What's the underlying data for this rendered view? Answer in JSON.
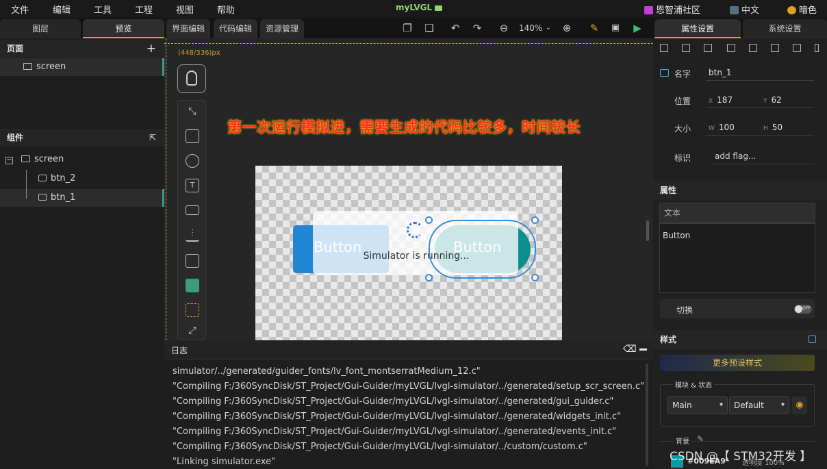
{
  "menu": [
    "文件",
    "编辑",
    "工具",
    "工程",
    "视图",
    "帮助"
  ],
  "app_title": "myLVGL",
  "right_menu": {
    "community": "恩智浦社区",
    "language": "中文",
    "theme": "暗色"
  },
  "left": {
    "tabs": [
      "图层",
      "预览"
    ],
    "pages_header": "页面",
    "page_items": [
      "screen"
    ],
    "components_header": "组件",
    "tree": [
      "screen",
      "btn_2",
      "btn_1"
    ]
  },
  "center": {
    "tabs": [
      "界面编辑",
      "代码编辑",
      "资源管理"
    ],
    "zoom": "140%",
    "coord": "(448/336)px",
    "notice": "第一次运行模拟进，需要生成的代码比较多，时间较长",
    "btn_labels": [
      "Button",
      "Button"
    ],
    "simulator_text": "Simulator is running...",
    "log_title": "日志",
    "log_lines": [
      "simulator/../generated/guider_fonts/lv_font_montserratMedium_12.c\"",
      "\"Compiling F:/360SyncDisk/ST_Project/Gui-Guider/myLVGL/lvgl-simulator/../generated/setup_scr_screen.c\"",
      "\"Compiling F:/360SyncDisk/ST_Project/Gui-Guider/myLVGL/lvgl-simulator/../generated/gui_guider.c\"",
      "\"Compiling F:/360SyncDisk/ST_Project/Gui-Guider/myLVGL/lvgl-simulator/../generated/widgets_init.c\"",
      "\"Compiling F:/360SyncDisk/ST_Project/Gui-Guider/myLVGL/lvgl-simulator/../generated/events_init.c\"",
      "\"Compiling F:/360SyncDisk/ST_Project/Gui-Guider/myLVGL/lvgl-simulator/../custom/custom.c\"",
      "\"Linking simulator.exe\""
    ]
  },
  "right": {
    "tabs": [
      "属性设置",
      "系统设置"
    ],
    "name_label": "名字",
    "name_value": "btn_1",
    "pos_label": "位置",
    "x_tag": "X",
    "x_value": "187",
    "y_tag": "Y",
    "y_value": "62",
    "size_label": "大小",
    "w_tag": "W",
    "w_value": "100",
    "h_tag": "H",
    "h_value": "50",
    "flag_label": "标识",
    "flag_value": "add flag...",
    "attr_header": "属性",
    "text_label": "文本",
    "text_value": "Button",
    "toggle_label": "切换",
    "toggle_state": "OFF",
    "style_header": "样式",
    "preset_button": "更多预设样式",
    "part_state_label": "模块 & 状态",
    "part_select": "Main",
    "state_select": "Default",
    "bg_label": "背景",
    "bg_color": "#009EA9",
    "opacity_text": "透明度 100%"
  },
  "watermark": "CSDN @【 STM32开发 】",
  "colors": {
    "accent": "#c9a227",
    "teal": "#0e8f8f",
    "blue": "#2186d3",
    "notice": "#ff2a2a"
  }
}
